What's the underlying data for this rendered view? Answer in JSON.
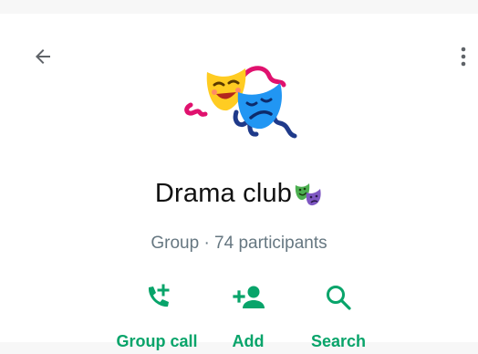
{
  "header": {
    "back_icon": "arrow-left-icon",
    "menu_icon": "more-vertical-icon"
  },
  "group": {
    "avatar_icon": "performing-arts-masks",
    "name": "Drama club",
    "name_emoji_icon": "performing-arts-masks",
    "subtitle": "Group · 74 participants"
  },
  "actions": [
    {
      "label": "Group call",
      "icon": "phone-plus-icon"
    },
    {
      "label": "Add",
      "icon": "add-person-icon"
    },
    {
      "label": "Search",
      "icon": "search-icon"
    }
  ],
  "colors": {
    "accent": "#08a46a",
    "text_primary": "#111111",
    "text_secondary": "#667781",
    "icon_grey": "#5f6368"
  }
}
